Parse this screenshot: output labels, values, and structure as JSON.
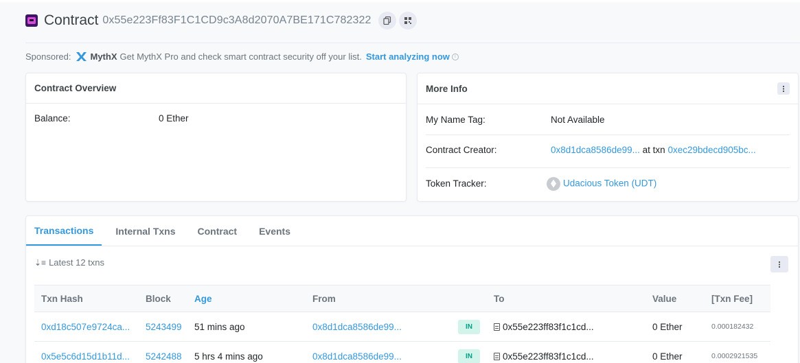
{
  "header": {
    "title": "Contract",
    "address": "0x55e223Ff83F1C1CD9c3A8d2070A7BE171C782322"
  },
  "sponsored": {
    "prefix": "Sponsored:",
    "brand": "MythX",
    "text": "Get MythX Pro and check smart contract security off your list.",
    "link": "Start analyzing now",
    "info": "i"
  },
  "overview": {
    "title": "Contract Overview",
    "balance_label": "Balance:",
    "balance_value": "0 Ether"
  },
  "more_info": {
    "title": "More Info",
    "name_tag_label": "My Name Tag:",
    "name_tag_value": "Not Available",
    "creator_label": "Contract Creator:",
    "creator_address": "0x8d1dca8586de99...",
    "creator_at_txn": "at txn",
    "creator_txn": "0xec29bdecd905bc...",
    "token_label": "Token Tracker:",
    "token_value": "Udacious Token (UDT)"
  },
  "tabs": [
    "Transactions",
    "Internal Txns",
    "Contract",
    "Events"
  ],
  "txn_count": "Latest 12 txns",
  "table": {
    "headers": {
      "hash": "Txn Hash",
      "block": "Block",
      "age": "Age",
      "from": "From",
      "to": "To",
      "value": "Value",
      "fee": "[Txn Fee]"
    },
    "rows": [
      {
        "hash": "0xd18c507e9724ca...",
        "block": "5243499",
        "age": "51 mins ago",
        "from": "0x8d1dca8586de99...",
        "direction": "IN",
        "to": "0x55e223ff83f1c1cd...",
        "value": "0 Ether",
        "fee": "0.000182432"
      },
      {
        "hash": "0x5e5c6d15d1b11d...",
        "block": "5242488",
        "age": "5 hrs 4 mins ago",
        "from": "0x8d1dca8586de99...",
        "direction": "IN",
        "to": "0x55e223ff83f1c1cd...",
        "value": "0 Ether",
        "fee": "0.0002921535"
      }
    ]
  },
  "colors": {
    "link": "#3498db",
    "in_badge_bg": "#d3f4ea",
    "in_badge_text": "#00a186"
  }
}
